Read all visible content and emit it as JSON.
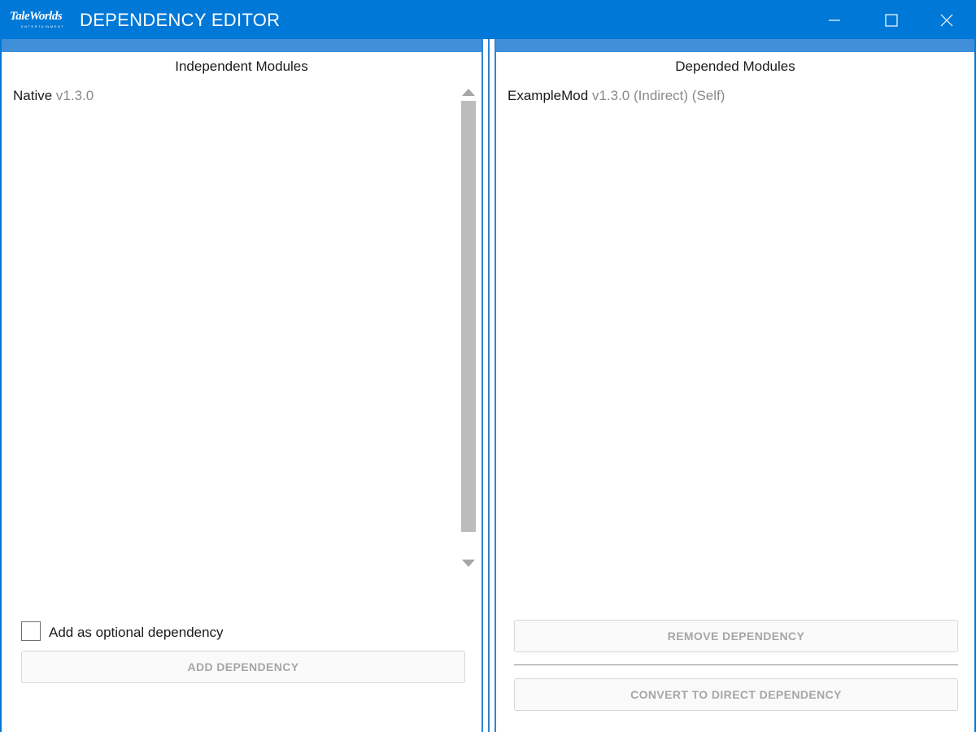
{
  "window": {
    "title": "DEPENDENCY EDITOR",
    "logo_text": "TaleWorlds",
    "logo_subtext": "ENTERTAINMENT",
    "accent_color": "#0078d7",
    "controls": [
      "minimize-icon",
      "maximize-icon",
      "close-icon"
    ]
  },
  "left_panel": {
    "header": "Independent Modules",
    "items": [
      {
        "name": "Native",
        "version": "v1.3.0"
      }
    ],
    "optional_checkbox": {
      "label": "Add as optional dependency",
      "checked": false
    },
    "add_button_label": "ADD DEPENDENCY"
  },
  "right_panel": {
    "header": "Depended Modules",
    "items": [
      {
        "name": "ExampleMod",
        "version": "v1.3.0",
        "tags": "(Indirect) (Self)"
      }
    ],
    "remove_button_label": "REMOVE DEPENDENCY",
    "convert_button_label": "CONVERT TO DIRECT DEPENDENCY"
  }
}
